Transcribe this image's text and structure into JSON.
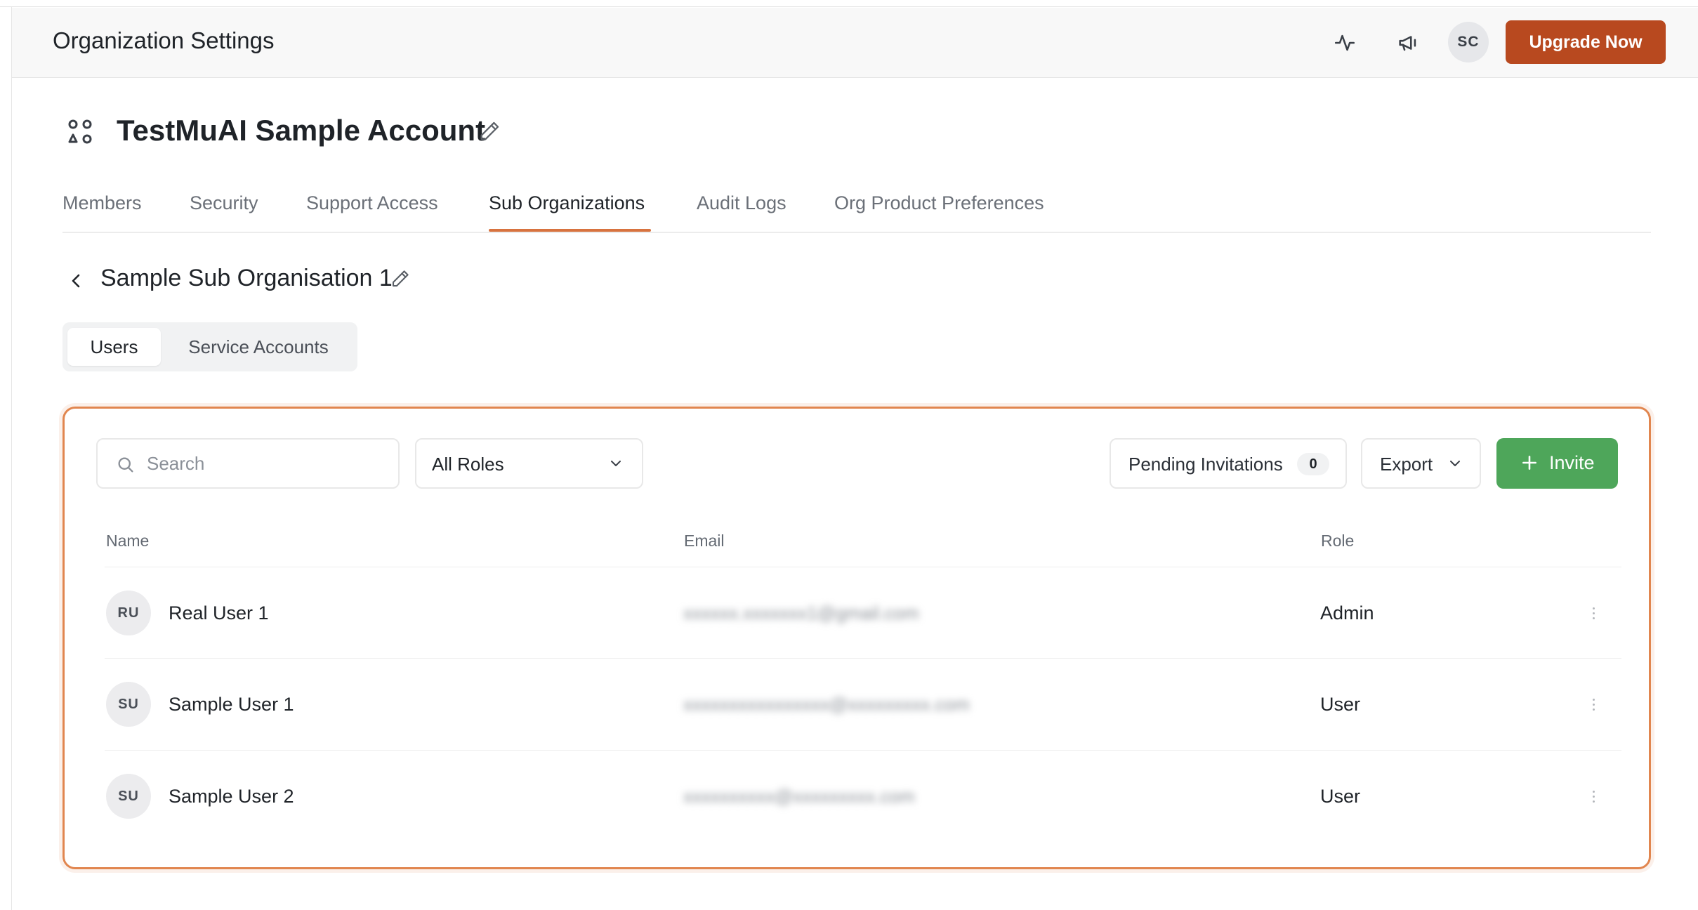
{
  "header": {
    "title": "Organization Settings",
    "icons": [
      "activity-icon",
      "megaphone-icon"
    ],
    "avatar_initials": "SC",
    "upgrade_label": "Upgrade Now"
  },
  "org": {
    "icon": "apps-icon",
    "name": "TestMuAI Sample Account"
  },
  "tabs": [
    {
      "label": "Members"
    },
    {
      "label": "Security"
    },
    {
      "label": "Support Access"
    },
    {
      "label": "Sub Organizations",
      "active": true
    },
    {
      "label": "Audit Logs"
    },
    {
      "label": "Org Product Preferences"
    }
  ],
  "sub_org": {
    "title": "Sample Sub Organisation 1"
  },
  "segments": [
    {
      "label": "Users",
      "active": true
    },
    {
      "label": "Service Accounts"
    }
  ],
  "toolbar": {
    "search_placeholder": "Search",
    "role_filter": "All Roles",
    "pending_label": "Pending Invitations",
    "pending_count": "0",
    "export_label": "Export",
    "invite_label": "Invite"
  },
  "table": {
    "columns": [
      "Name",
      "Email",
      "Role"
    ],
    "rows": [
      {
        "initials": "RU",
        "name": "Real User 1",
        "email": "xxxxxx.xxxxxxx1@gmail.com",
        "role": "Admin"
      },
      {
        "initials": "SU",
        "name": "Sample User 1",
        "email": "xxxxxxxxxxxxxxxx@xxxxxxxxx.com",
        "role": "User"
      },
      {
        "initials": "SU",
        "name": "Sample User 2",
        "email": "xxxxxxxxxx@xxxxxxxxx.com",
        "role": "User"
      }
    ]
  },
  "colors": {
    "accent_orange": "#d8733f",
    "upgrade_button": "#b8491f",
    "invite_button": "#4ea65a",
    "card_border": "#e1864f"
  }
}
